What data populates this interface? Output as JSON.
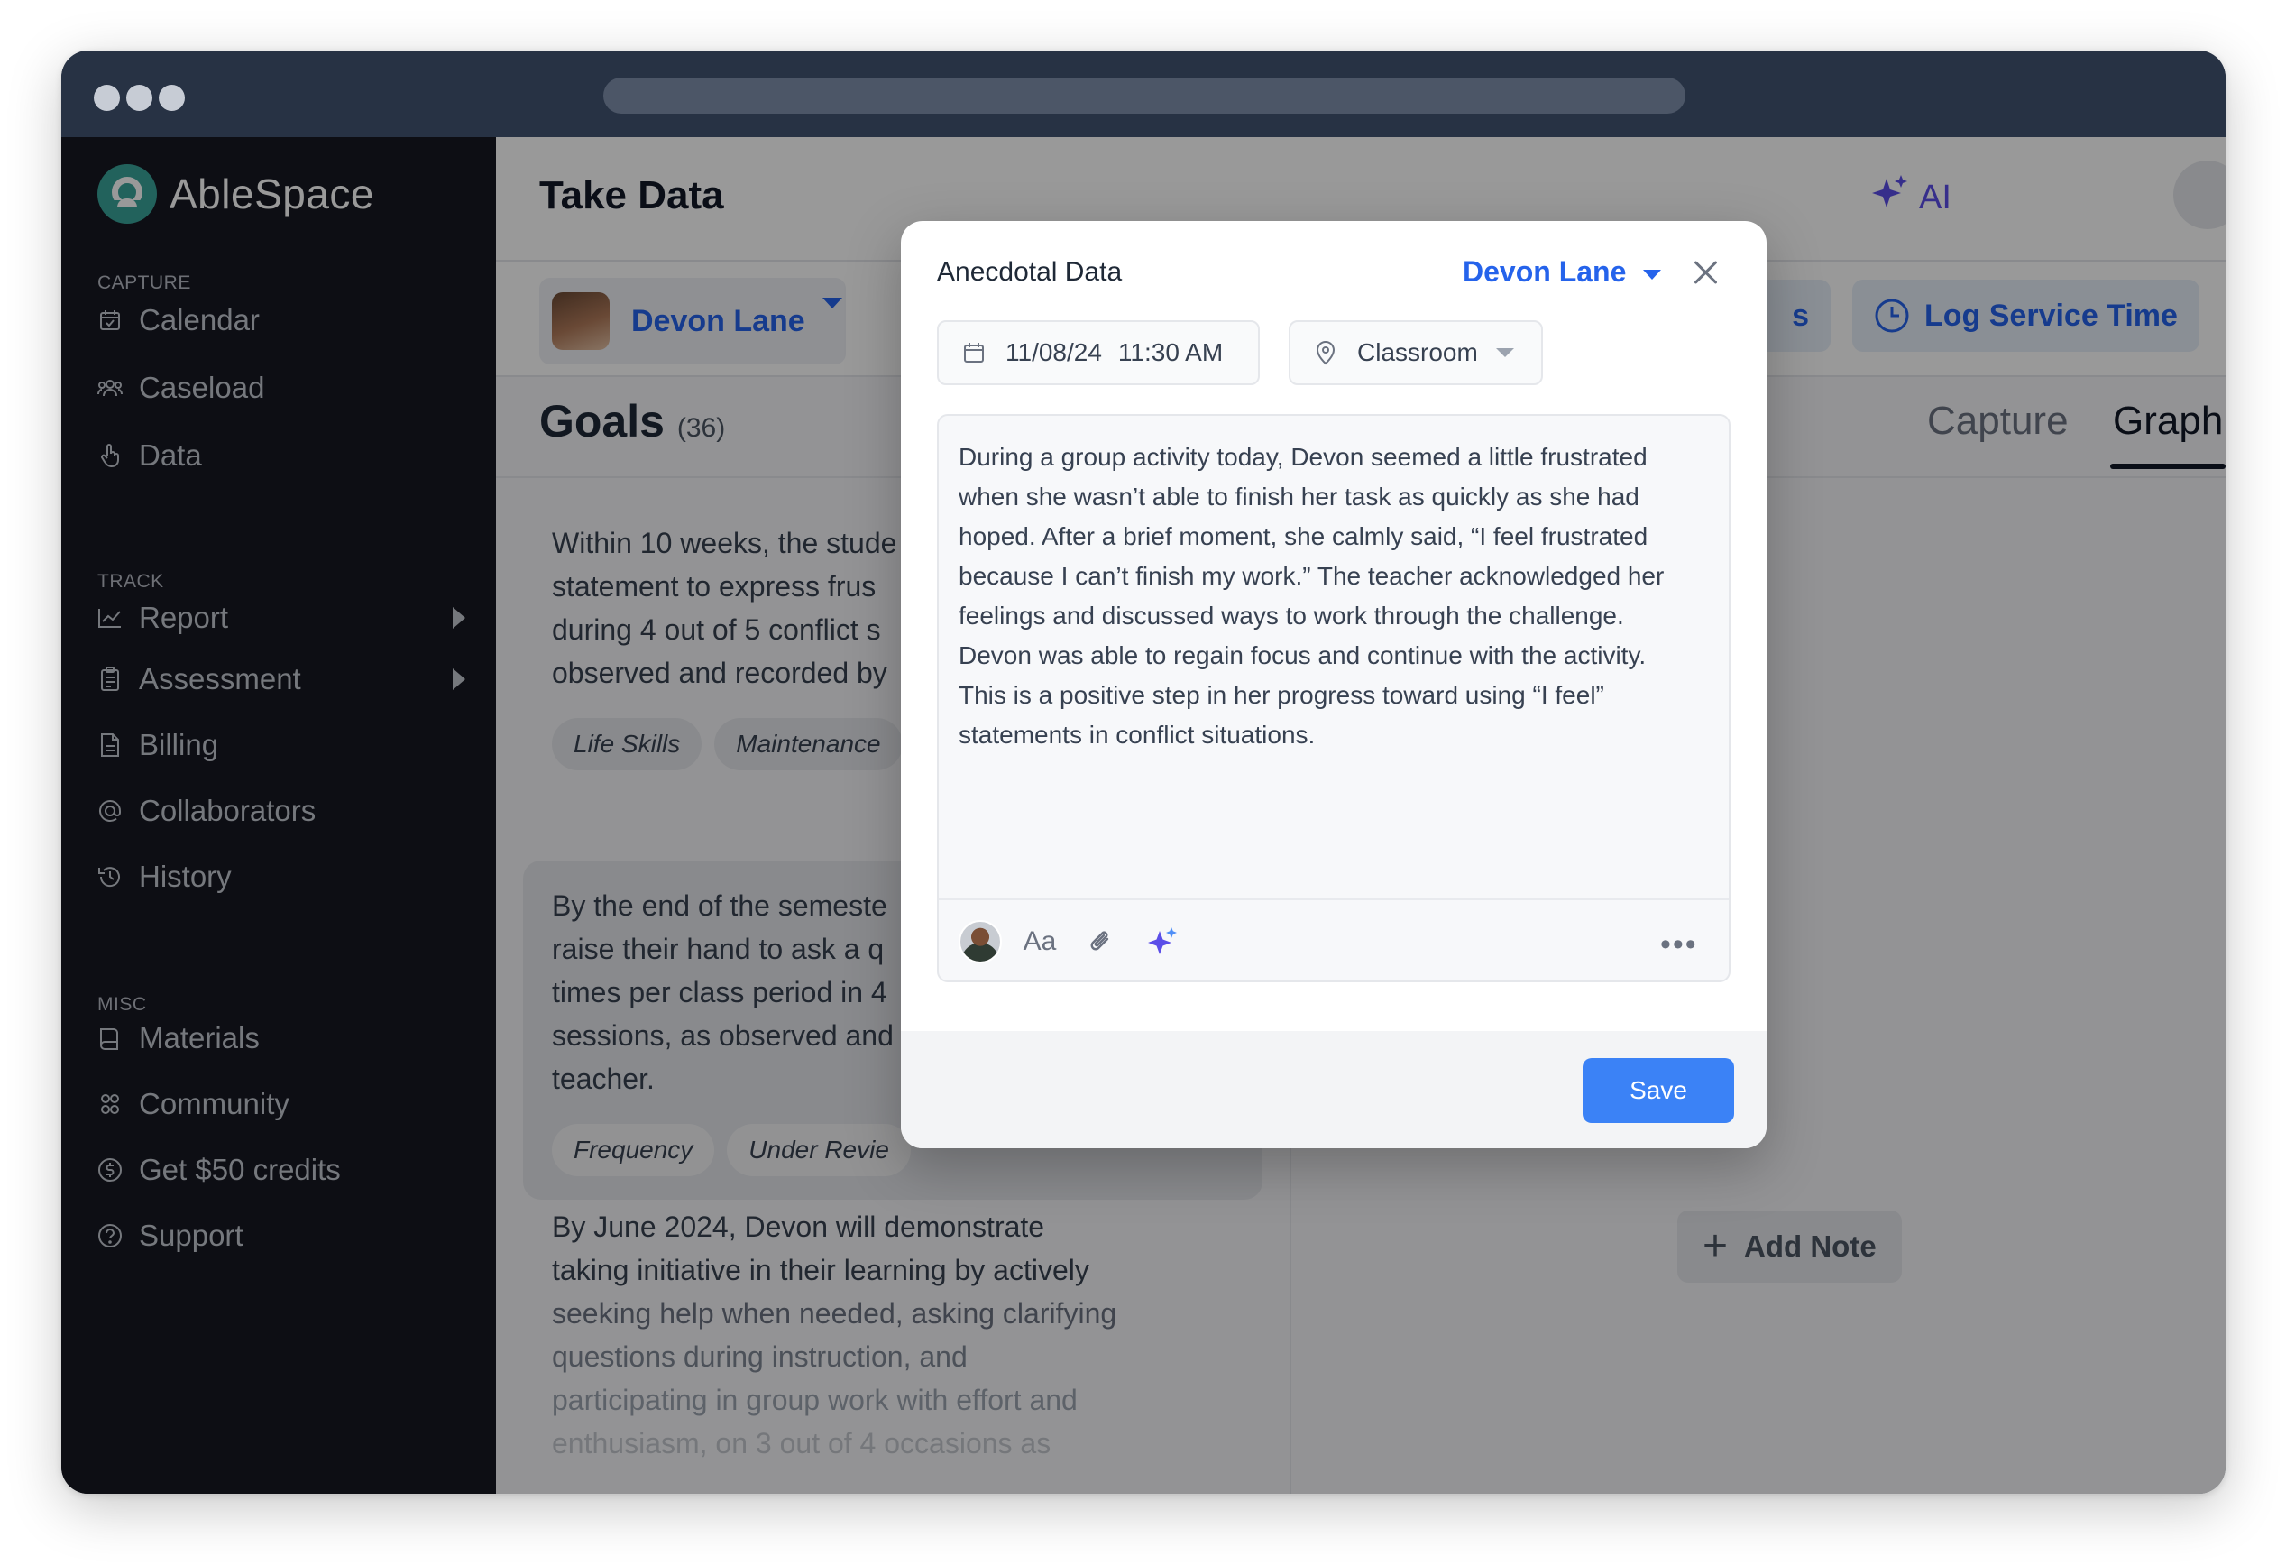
{
  "app": {
    "name": "AbleSpace"
  },
  "sidebar": {
    "sections": [
      {
        "label": "CAPTURE"
      },
      {
        "label": "TRACK"
      },
      {
        "label": "MISC"
      }
    ],
    "items": [
      {
        "label": "Calendar",
        "icon": "calendar-icon"
      },
      {
        "label": "Caseload",
        "icon": "people-icon"
      },
      {
        "label": "Data",
        "icon": "hand-tap-icon"
      },
      {
        "label": "Report",
        "icon": "line-chart-icon"
      },
      {
        "label": "Assessment",
        "icon": "clipboard-icon"
      },
      {
        "label": "Billing",
        "icon": "document-icon"
      },
      {
        "label": "Collaborators",
        "icon": "at-sign-icon"
      },
      {
        "label": "History",
        "icon": "history-icon"
      },
      {
        "label": "Materials",
        "icon": "book-icon"
      },
      {
        "label": "Community",
        "icon": "community-icon"
      },
      {
        "label": "Get $50 credits",
        "icon": "dollar-circle-icon"
      },
      {
        "label": "Support",
        "icon": "help-circle-icon"
      }
    ]
  },
  "header": {
    "title": "Take Data",
    "ai_label": "AI"
  },
  "toolbar": {
    "student_name": "Devon Lane",
    "btn_partial": "s",
    "log_service_time": "Log Service Time"
  },
  "goals": {
    "title": "Goals",
    "count": "(36)",
    "tabs": [
      "Capture",
      "Graph"
    ],
    "active_tab": "Graph",
    "items": [
      {
        "text_lines": [
          "Within 10 weeks, the stude",
          "statement to express frus",
          "during 4 out of 5 conflict s",
          "observed and recorded by"
        ],
        "tags": [
          "Life Skills",
          "Maintenance"
        ]
      },
      {
        "text_lines": [
          "By the end of the semeste",
          "raise their hand to ask a q",
          "times per class period in 4",
          "sessions, as observed and",
          "teacher."
        ],
        "tags": [
          "Frequency",
          "Under Revie"
        ]
      },
      {
        "text_lines": [
          "By June 2024, Devon will demonstrate",
          "taking initiative in their learning by actively",
          "seeking help when needed, asking clarifying",
          "questions during instruction, and",
          "participating in group work with effort and",
          "enthusiasm, on 3 out of 4 occasions as"
        ]
      }
    ],
    "add_note": "Add Note"
  },
  "modal": {
    "title": "Anecdotal Data",
    "student": "Devon Lane",
    "date": "11/08/24",
    "time": "11:30 AM",
    "location": "Classroom",
    "note_lines": [
      "During a group activity today, Devon seemed a little frustrated",
      "when she wasn’t able to finish her task as quickly as she had",
      "hoped. After a brief moment, she calmly said, “I feel frustrated",
      "because I can’t finish my work.” The teacher acknowledged her",
      "feelings and discussed ways to work through the challenge.",
      "Devon was able to regain focus and continue with the activity.",
      "This is a positive step in her progress toward using “I feel”",
      "statements in conflict situations."
    ],
    "format_label": "Aa",
    "more_label": "•••",
    "save_label": "Save"
  },
  "colors": {
    "accent_blue": "#2563eb",
    "save_blue": "#3b82f6",
    "ai_purple": "#5b4ee8",
    "brand_teal": "#3aa39a",
    "sidebar_bg": "#161822"
  }
}
